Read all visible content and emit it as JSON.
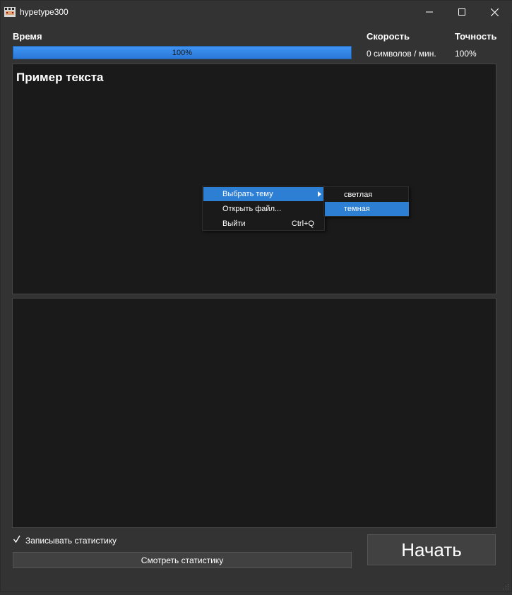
{
  "window": {
    "title": "hypetype300",
    "icons": {
      "app": "app-icon",
      "minimize": "minimize-icon",
      "maximize": "maximize-icon",
      "close": "close-icon"
    }
  },
  "stats": {
    "time_label": "Время",
    "progress_value": 1.0,
    "progress_text": "100%",
    "speed_label": "Скорость",
    "speed_value": "0 символов / мин.",
    "accuracy_label": "Точность",
    "accuracy_value": "100%"
  },
  "sample_pane": {
    "text": "Пример текста"
  },
  "context_menu": {
    "items": [
      {
        "label": "Выбрать тему",
        "shortcut": "",
        "has_submenu": true,
        "active": true
      },
      {
        "label": "Открыть файл...",
        "shortcut": ""
      },
      {
        "label": "Выйти",
        "shortcut": "Ctrl+Q"
      }
    ],
    "submenu": {
      "items": [
        {
          "label": "светлая",
          "active": false
        },
        {
          "label": "темная",
          "active": true
        }
      ]
    }
  },
  "controls": {
    "record_stats_label": "Записывать статистику",
    "record_stats_checked": true,
    "view_stats_label": "Смотреть статистику",
    "start_label": "Начать"
  },
  "colors": {
    "background": "#333333",
    "pane": "#1a1a1a",
    "accent": "#2d7fd4"
  }
}
